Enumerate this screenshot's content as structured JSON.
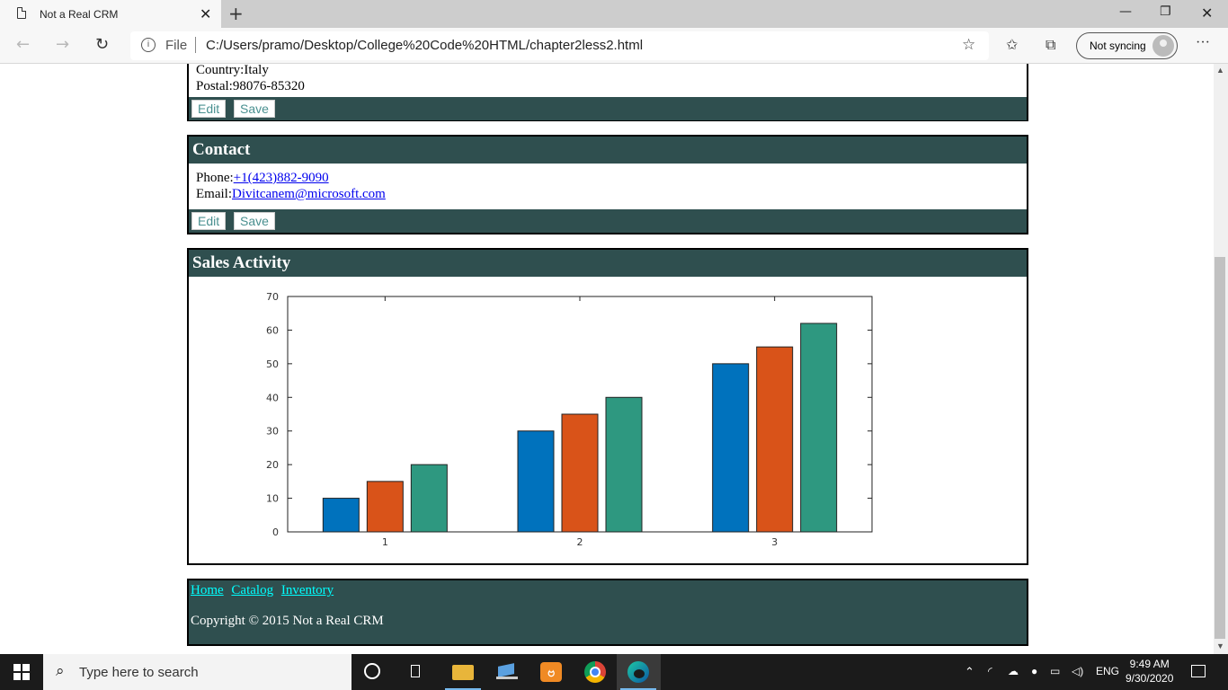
{
  "browser": {
    "tab_title": "Not a Real CRM",
    "address_prefix": "File",
    "url": "C:/Users/pramo/Desktop/College%20Code%20HTML/chapter2less2.html",
    "sync_label": "Not syncing"
  },
  "address_panel": {
    "country_partial": "Country:Italy",
    "postal": "Postal:98076-85320",
    "edit_label": "Edit",
    "save_label": "Save"
  },
  "contact_panel": {
    "title": "Contact",
    "phone_label": "Phone:",
    "phone_value": "+1(423)882-9090",
    "email_label": "Email:",
    "email_value": "Divitcanem@microsoft.com",
    "edit_label": "Edit",
    "save_label": "Save"
  },
  "sales_panel": {
    "title": "Sales Activity"
  },
  "chart_data": {
    "type": "bar",
    "categories": [
      "1",
      "2",
      "3"
    ],
    "series": [
      {
        "values": [
          10,
          30,
          50
        ]
      },
      {
        "values": [
          15,
          35,
          55
        ]
      },
      {
        "values": [
          20,
          40,
          62
        ]
      }
    ],
    "colors": [
      "#0072bd",
      "#d95319",
      "#2e9880"
    ],
    "yticks": [
      "0",
      "10",
      "20",
      "30",
      "40",
      "50",
      "60",
      "70"
    ],
    "ylim": [
      0,
      70
    ],
    "title": "",
    "xlabel": "",
    "ylabel": ""
  },
  "footer": {
    "links": [
      "Home",
      "Catalog",
      "Inventory"
    ],
    "copyright": "Copyright © 2015 Not a Real CRM"
  },
  "taskbar": {
    "search_placeholder": "Type here to search",
    "lang": "ENG",
    "time": "9:49 AM",
    "date": "9/30/2020"
  }
}
